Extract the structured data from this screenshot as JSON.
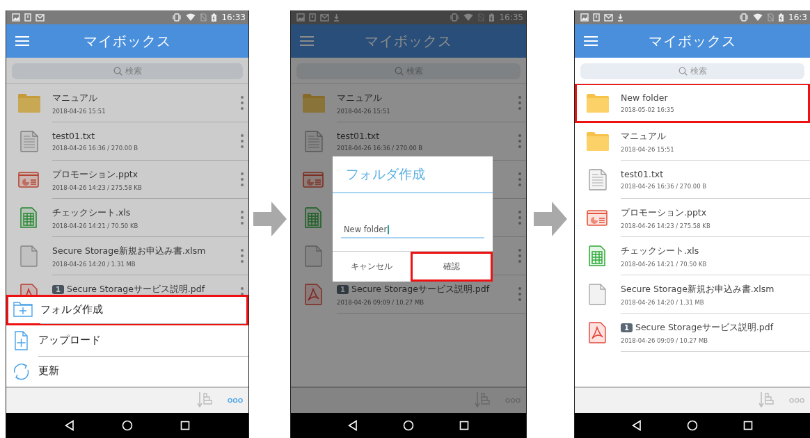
{
  "phones": [
    {
      "list_dimmed": true,
      "screen_dimmed": false,
      "status_bar": {
        "time": "16:33",
        "download_notice": false
      },
      "title": "マイボックス",
      "search_placeholder": "検索",
      "row_menus": true,
      "more_active": true,
      "rows": [
        {
          "kind": "folder",
          "title": "マニュアル",
          "date": "2018-04-26 15:51",
          "highlighted": false
        },
        {
          "kind": "text",
          "title": "test01.txt",
          "date": "2018-04-26 16:36 / 270.00 B",
          "highlighted": false
        },
        {
          "kind": "slides",
          "title": "プロモーション.pptx",
          "date": "2018-04-26 14:23 / 275.58 KB",
          "highlighted": false
        },
        {
          "kind": "sheet",
          "title": "チェックシート.xls",
          "date": "2018-04-26 14:21 / 70.50 KB",
          "highlighted": false
        },
        {
          "kind": "document",
          "title": "Secure Storage新規お申込み書.xlsm",
          "date": "2018-04-26 14:20 / 1.31 MB",
          "highlighted": false
        },
        {
          "kind": "pdf",
          "badge": "1",
          "title": "Secure Storageサービス説明.pdf",
          "highlighted": false
        }
      ],
      "sheet": [
        {
          "kind": "new-folder",
          "label": "フォルダ作成",
          "highlighted": true
        },
        {
          "kind": "upload",
          "label": "アップロード",
          "highlighted": false
        },
        {
          "kind": "refresh",
          "label": "更新",
          "highlighted": false
        }
      ]
    },
    {
      "list_dimmed": false,
      "screen_dimmed": true,
      "status_bar": {
        "time": "16:35",
        "download_notice": true
      },
      "title": "マイボックス",
      "search_placeholder": "検索",
      "row_menus": true,
      "more_active": false,
      "rows": [
        {
          "kind": "folder",
          "title": "マニュアル",
          "date": "2018-04-26 15:51",
          "highlighted": false
        },
        {
          "kind": "text",
          "title": "test01.txt",
          "date": "2018-04-26 16:36 / 270.00 B",
          "highlighted": false
        },
        {
          "kind": "slides",
          "highlighted": false
        },
        {
          "kind": "sheet",
          "highlighted": false
        },
        {
          "kind": "document",
          "highlighted": false
        },
        {
          "kind": "pdf",
          "badge": "1",
          "title": "Secure Storageサービス説明.pdf",
          "date": "2018-04-26 09:09 / 10.27 MB",
          "highlighted": false
        }
      ],
      "dialog": {
        "title": "フォルダ作成",
        "value": "New folder",
        "buttons": [
          {
            "label": "キャンセル",
            "highlighted": false
          },
          {
            "label": "確認",
            "highlighted": true
          }
        ]
      }
    },
    {
      "list_dimmed": false,
      "screen_dimmed": false,
      "status_bar": {
        "time": "16:3",
        "download_notice": true
      },
      "title": "マイボックス",
      "search_placeholder": "検索",
      "row_menus": false,
      "more_active": false,
      "rows": [
        {
          "kind": "folder",
          "title": "New folder",
          "date": "2018-05-02 16:35",
          "highlighted": true
        },
        {
          "kind": "folder",
          "title": "マニュアル",
          "date": "2018-04-26 15:51",
          "highlighted": false
        },
        {
          "kind": "text",
          "title": "test01.txt",
          "date": "2018-04-26 16:36 / 270.00 B",
          "highlighted": false
        },
        {
          "kind": "slides",
          "title": "プロモーション.pptx",
          "date": "2018-04-26 14:23 / 275.58 KB",
          "highlighted": false
        },
        {
          "kind": "sheet",
          "title": "チェックシート.xls",
          "date": "2018-04-26 14:21 / 70.50 KB",
          "highlighted": false
        },
        {
          "kind": "document",
          "title": "Secure Storage新規お申込み書.xlsm",
          "date": "2018-04-26 14:20 / 1.31 MB",
          "highlighted": false
        },
        {
          "kind": "pdf",
          "badge": "1",
          "title": "Secure Storageサービス説明.pdf",
          "date": "2018-04-26 09:09 / 10.27 MB",
          "highlighted": false
        }
      ]
    }
  ]
}
